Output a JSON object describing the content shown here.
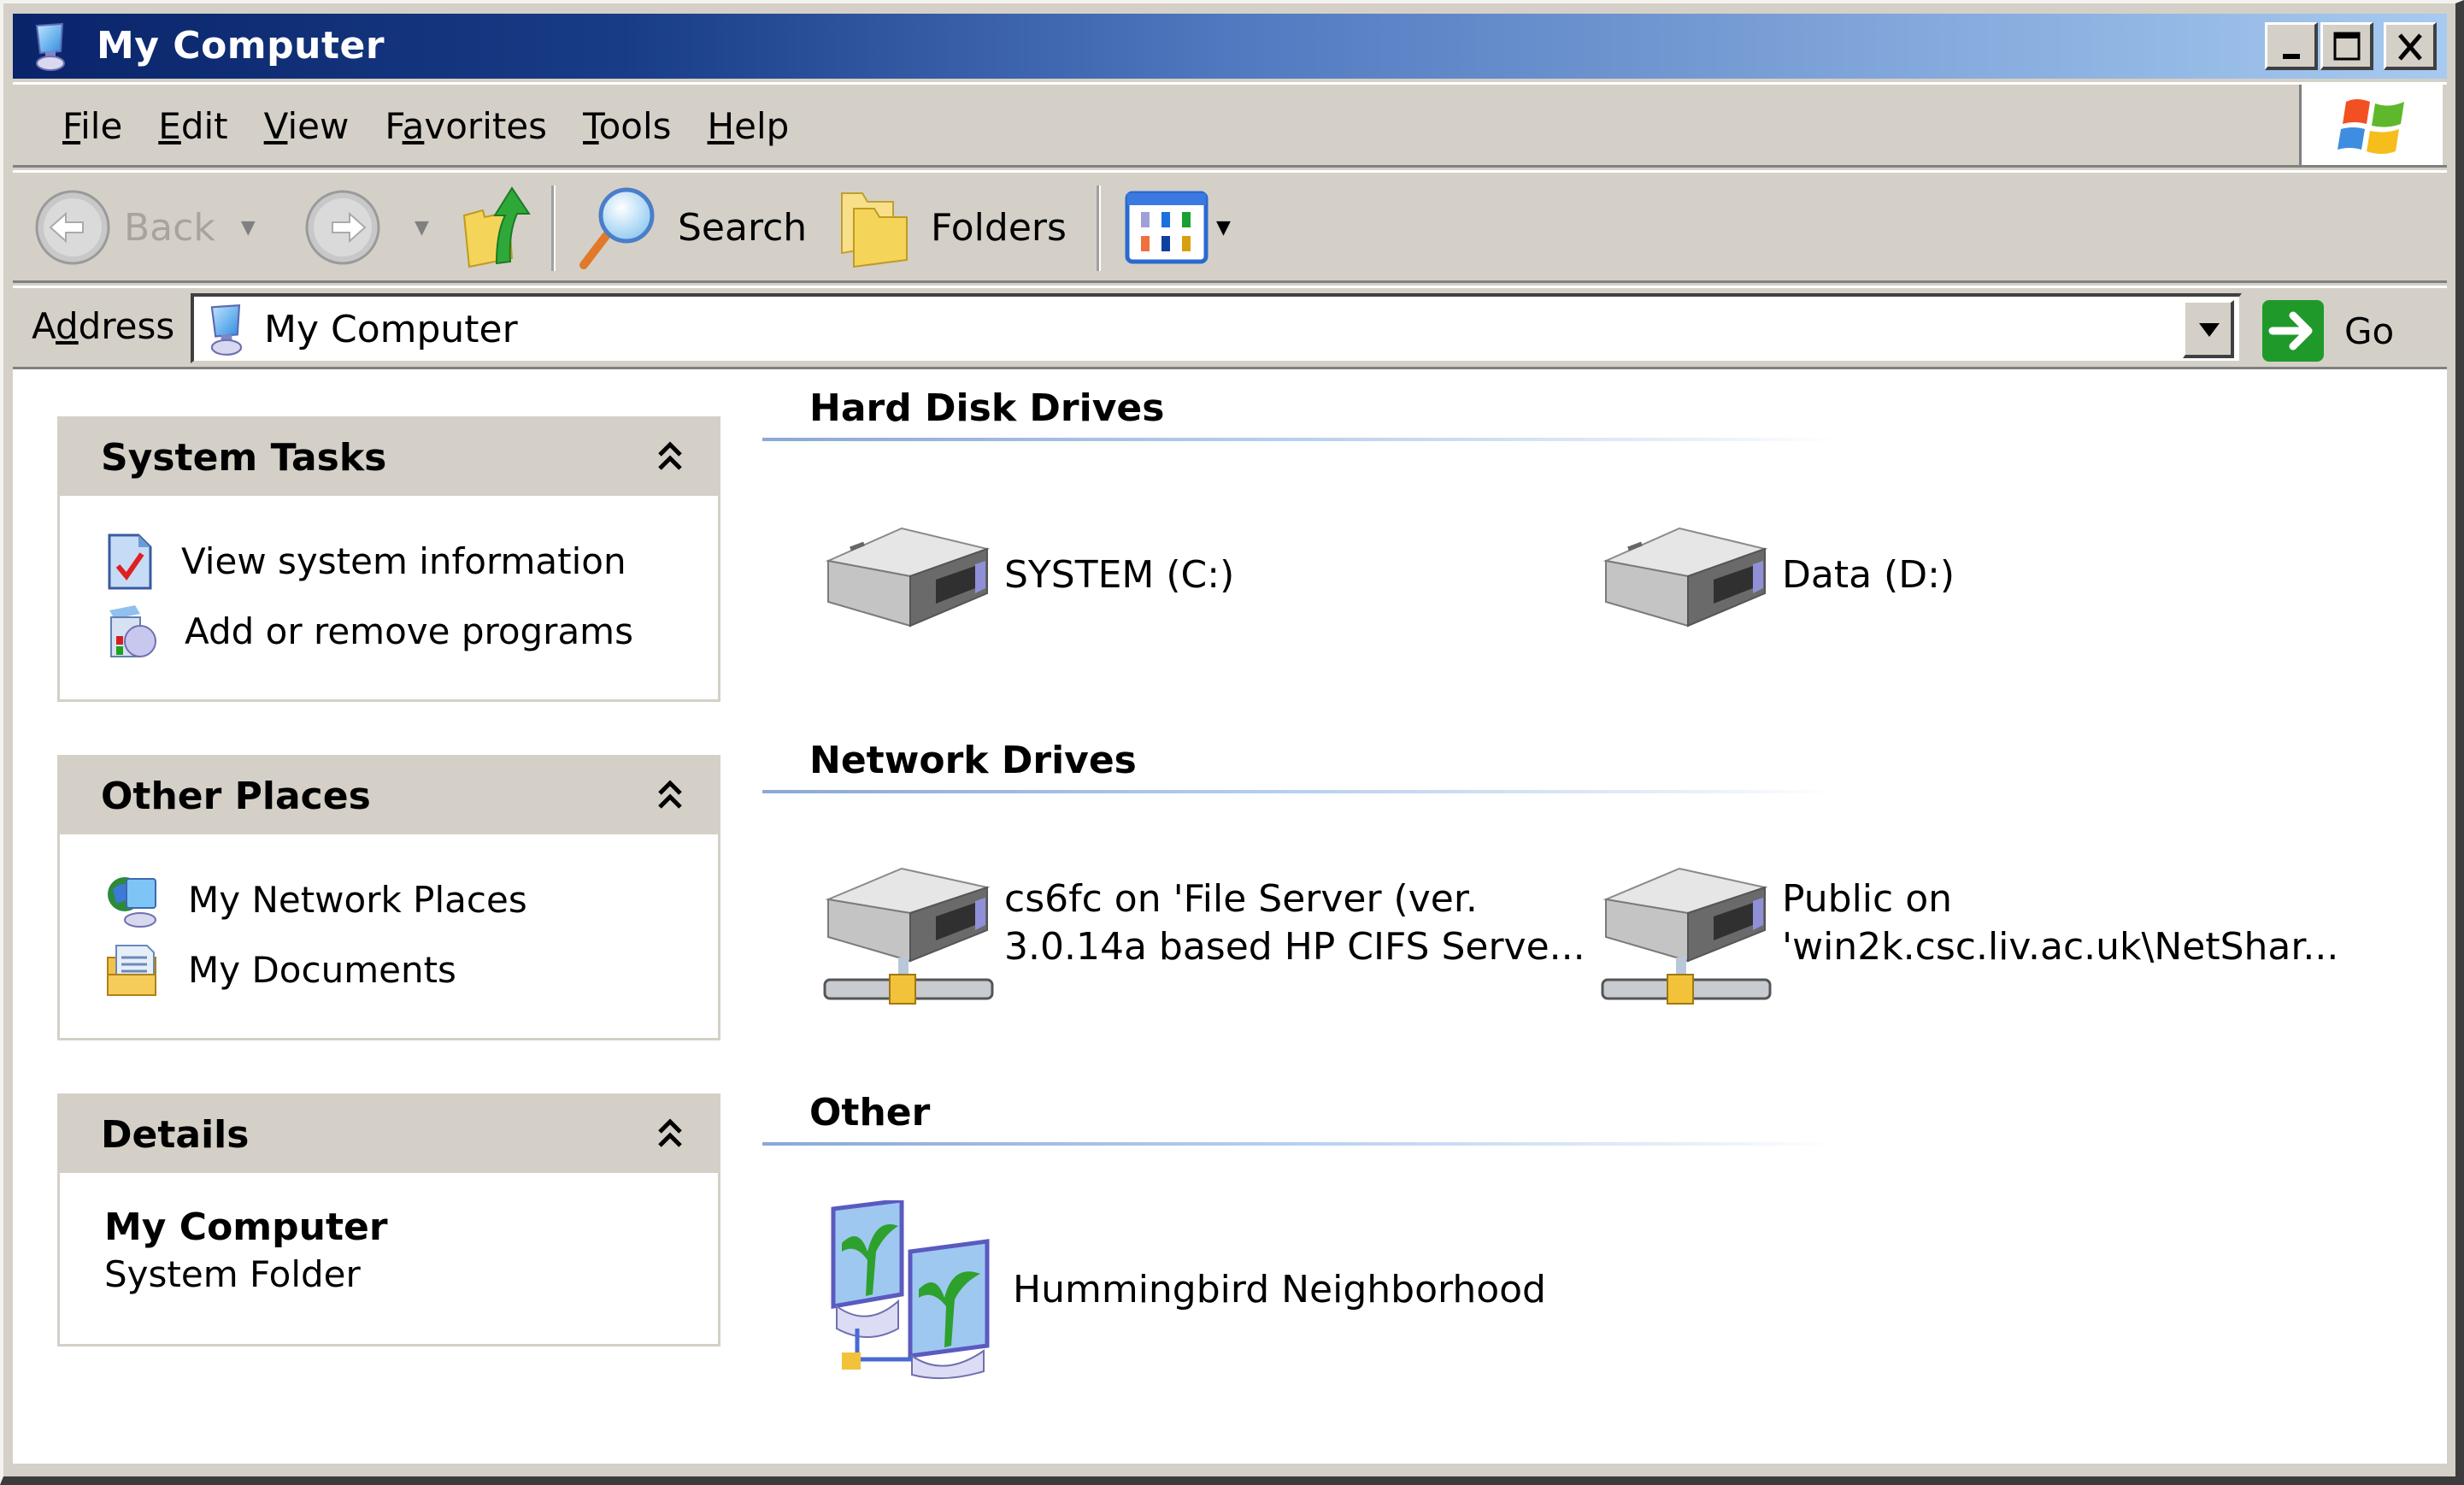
{
  "window": {
    "title": "My Computer",
    "controls": {
      "minimize": "Minimize",
      "maximize": "Maximize",
      "close": "Close"
    }
  },
  "menu": {
    "items": [
      {
        "label": "File",
        "accel": "F",
        "rest": "ile"
      },
      {
        "label": "Edit",
        "accel": "E",
        "rest": "dit"
      },
      {
        "label": "View",
        "accel": "V",
        "rest": "iew"
      },
      {
        "label": "Favorites",
        "pre": "F",
        "accel": "a",
        "rest": "vorites"
      },
      {
        "label": "Tools",
        "accel": "T",
        "rest": "ools"
      },
      {
        "label": "Help",
        "accel": "H",
        "rest": "elp"
      }
    ]
  },
  "toolbar": {
    "back_label": "Back",
    "search_label": "Search",
    "folders_label": "Folders"
  },
  "address": {
    "label_pre": "A",
    "label_accel": "d",
    "label_rest": "dress",
    "value": "My Computer",
    "go_label": "Go"
  },
  "sidebar": {
    "system_tasks": {
      "title": "System Tasks",
      "items": [
        {
          "label": "View system information",
          "icon": "system-info-icon"
        },
        {
          "label": "Add or remove programs",
          "icon": "add-remove-programs-icon"
        }
      ]
    },
    "other_places": {
      "title": "Other Places",
      "items": [
        {
          "label": "My Network Places",
          "icon": "network-places-icon"
        },
        {
          "label": "My Documents",
          "icon": "my-documents-icon"
        }
      ]
    },
    "details": {
      "title": "Details",
      "name": "My Computer",
      "type": "System Folder"
    }
  },
  "main": {
    "sections": [
      {
        "title": "Hard Disk Drives",
        "items": [
          {
            "label": "SYSTEM (C:)",
            "icon": "hard-drive-icon"
          },
          {
            "label": "Data (D:)",
            "icon": "hard-drive-icon"
          }
        ]
      },
      {
        "title": "Network Drives",
        "items": [
          {
            "line1": "cs6fc on 'File Server (ver.",
            "line2": "3.0.14a based HP CIFS Serve...",
            "icon": "network-drive-icon"
          },
          {
            "line1": "Public on",
            "line2": "'win2k.csc.liv.ac.uk\\NetShar...",
            "icon": "network-drive-icon"
          }
        ]
      },
      {
        "title": "Other",
        "items": [
          {
            "label": "Hummingbird Neighborhood",
            "icon": "hummingbird-neighborhood-icon"
          }
        ]
      }
    ]
  }
}
